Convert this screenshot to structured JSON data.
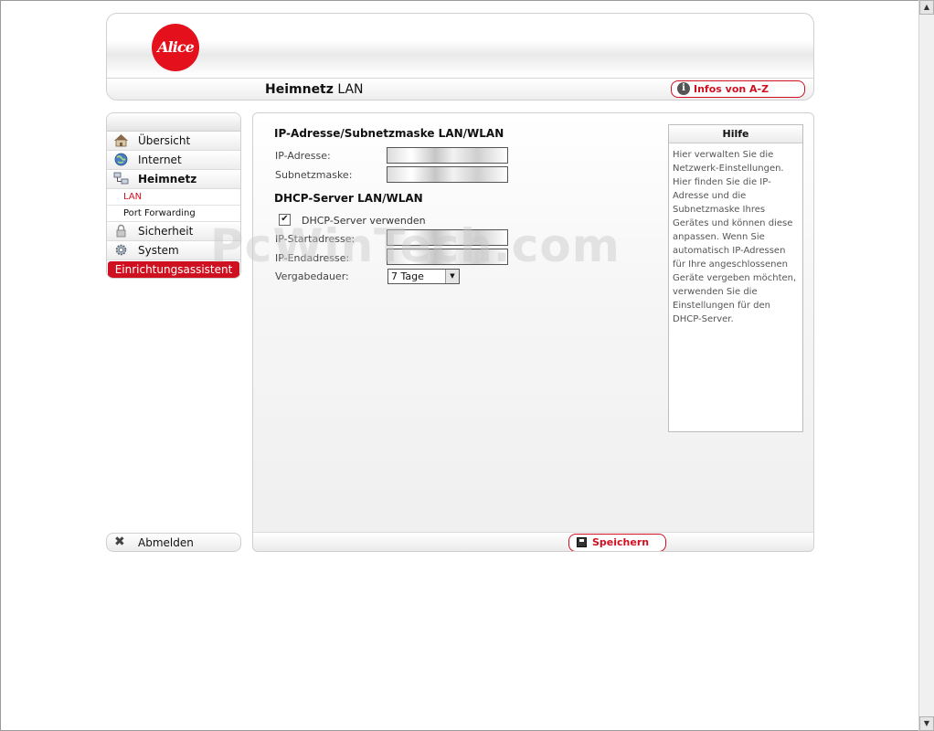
{
  "header": {
    "logo_text": "Alice",
    "page_title_bold": "Heimnetz",
    "page_title_rest": " LAN",
    "infos_button": "Infos von A-Z"
  },
  "sidebar": {
    "items": [
      {
        "label": "Übersicht",
        "icon": "home-icon"
      },
      {
        "label": "Internet",
        "icon": "globe-icon"
      },
      {
        "label": "Heimnetz",
        "icon": "network-icon"
      }
    ],
    "subitems": [
      {
        "label": "LAN",
        "active": true
      },
      {
        "label": "Port Forwarding",
        "active": false
      }
    ],
    "items_after": [
      {
        "label": "Sicherheit",
        "icon": "lock-icon"
      },
      {
        "label": "System",
        "icon": "gear-icon"
      }
    ],
    "wizard_label": "Einrichtungsassistent",
    "logout_label": "Abmelden"
  },
  "main": {
    "section_ip_title": "IP-Adresse/Subnetzmaske LAN/WLAN",
    "ip_label": "IP-Adresse:",
    "subnet_label": "Subnetzmaske:",
    "section_dhcp_title": "DHCP-Server LAN/WLAN",
    "dhcp_checkbox_label": "DHCP-Server verwenden",
    "dhcp_checked": true,
    "start_label": "IP-Startadresse:",
    "end_label": "IP-Endadresse:",
    "lease_label": "Vergabedauer:",
    "lease_value": "7 Tage",
    "save_button": "Speichern"
  },
  "help": {
    "title": "Hilfe",
    "text": "Hier verwalten Sie die Netzwerk-Einstellungen. Hier finden Sie die IP-Adresse und die Subnetzmaske Ihres Gerätes und können diese anpassen. Wenn Sie automatisch IP-Adressen für Ihre angeschlossenen Geräte vergeben möchten, verwenden Sie die Einstellungen für den DHCP-Server."
  },
  "watermark": "PcWinTech.com",
  "colors": {
    "accent": "#d01020",
    "logo": "#e4111c"
  }
}
